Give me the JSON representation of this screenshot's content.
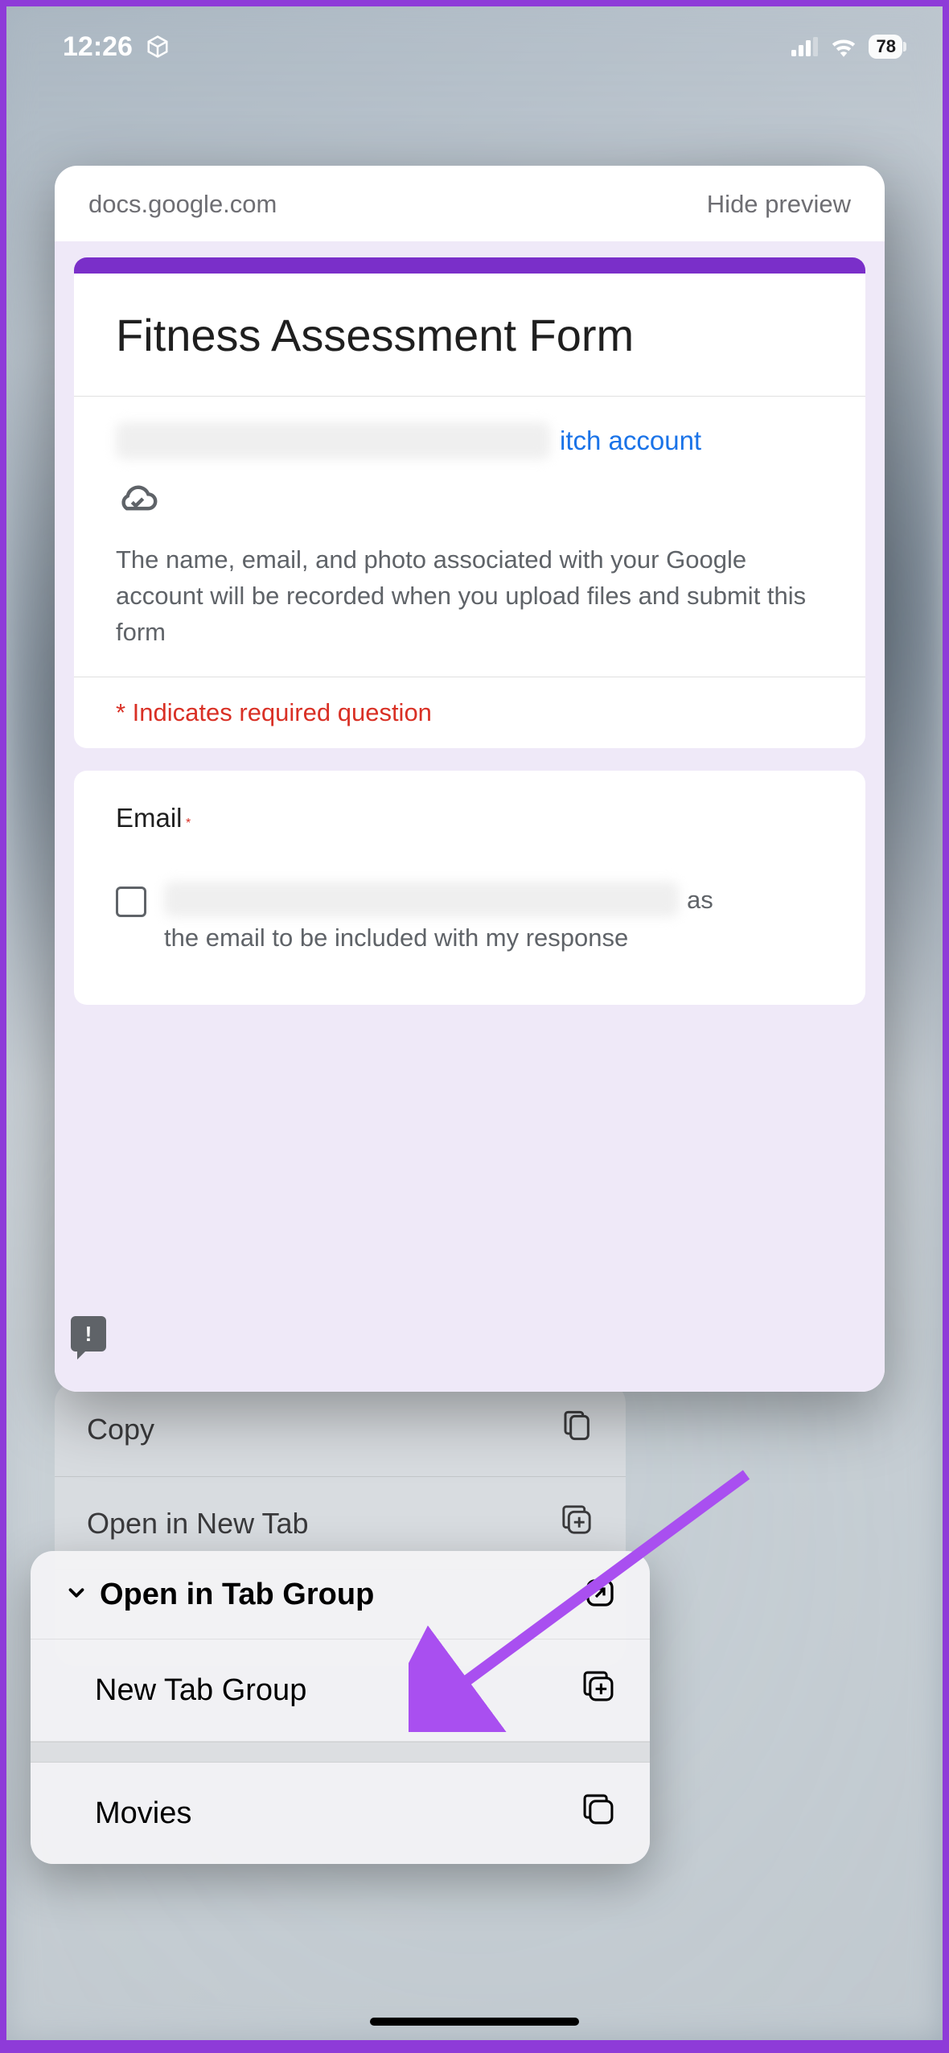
{
  "status_bar": {
    "time": "12:26",
    "battery_percent": "78"
  },
  "preview": {
    "url": "docs.google.com",
    "hide_label": "Hide preview",
    "form": {
      "title": "Fitness Assessment Form",
      "switch_account": "itch account",
      "description": "The name, email, and photo associated with your Google account will be recorded when you upload files and submit this form",
      "required_note": "* Indicates required question",
      "email_label": "Email",
      "email_star": "*",
      "email_consent_tail": "as",
      "email_consent_line2": "the email to be included with my response"
    }
  },
  "context_menu": {
    "copy": "Copy",
    "new_tab": "Open in New Tab",
    "tab_group_header": "Open in Tab Group",
    "new_tab_group": "New Tab Group",
    "movies": "Movies"
  }
}
